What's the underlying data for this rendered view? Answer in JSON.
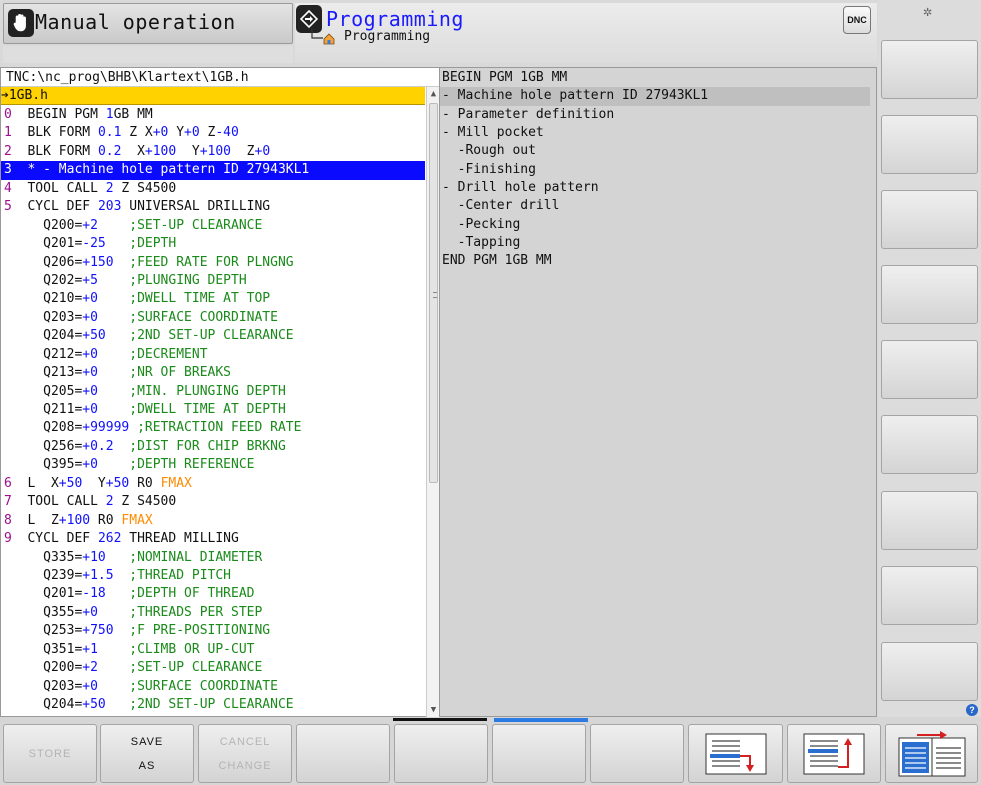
{
  "header": {
    "mode_title": "Manual operation",
    "programming_title": "Programming",
    "programming_subtitle": "Programming",
    "dnc_label": "DNC"
  },
  "editor": {
    "path": "TNC:\\nc_prog\\BHB\\Klartext\\1GB.h",
    "file_name": "1GB.h",
    "selected_line": 3,
    "lines": [
      {
        "num": "0",
        "text": "BEGIN PGM 1GB MM"
      },
      {
        "num": "1",
        "text": "BLK FORM 0.1 Z X+0 Y+0 Z-40"
      },
      {
        "num": "2",
        "text": "BLK FORM 0.2  X+100  Y+100  Z+0"
      },
      {
        "num": "3",
        "text": "* - Machine hole pattern ID 27943KL1"
      },
      {
        "num": "4",
        "text": "TOOL CALL 2 Z S4500"
      },
      {
        "num": "5",
        "text": "CYCL DEF 203 UNIVERSAL DRILLING"
      },
      {
        "num": "",
        "text": "  Q200=+2    ;SET-UP CLEARANCE"
      },
      {
        "num": "",
        "text": "  Q201=-25   ;DEPTH"
      },
      {
        "num": "",
        "text": "  Q206=+150  ;FEED RATE FOR PLNGNG"
      },
      {
        "num": "",
        "text": "  Q202=+5    ;PLUNGING DEPTH"
      },
      {
        "num": "",
        "text": "  Q210=+0    ;DWELL TIME AT TOP"
      },
      {
        "num": "",
        "text": "  Q203=+0    ;SURFACE COORDINATE"
      },
      {
        "num": "",
        "text": "  Q204=+50   ;2ND SET-UP CLEARANCE"
      },
      {
        "num": "",
        "text": "  Q212=+0    ;DECREMENT"
      },
      {
        "num": "",
        "text": "  Q213=+0    ;NR OF BREAKS"
      },
      {
        "num": "",
        "text": "  Q205=+0    ;MIN. PLUNGING DEPTH"
      },
      {
        "num": "",
        "text": "  Q211=+0    ;DWELL TIME AT DEPTH"
      },
      {
        "num": "",
        "text": "  Q208=+99999 ;RETRACTION FEED RATE"
      },
      {
        "num": "",
        "text": "  Q256=+0.2  ;DIST FOR CHIP BRKNG"
      },
      {
        "num": "",
        "text": "  Q395=+0    ;DEPTH REFERENCE"
      },
      {
        "num": "6",
        "text": "L  X+50  Y+50 R0 FMAX"
      },
      {
        "num": "7",
        "text": "TOOL CALL 2 Z S4500"
      },
      {
        "num": "8",
        "text": "L  Z+100 R0 FMAX"
      },
      {
        "num": "9",
        "text": "CYCL DEF 262 THREAD MILLING"
      },
      {
        "num": "",
        "text": "  Q335=+10   ;NOMINAL DIAMETER"
      },
      {
        "num": "",
        "text": "  Q239=+1.5  ;THREAD PITCH"
      },
      {
        "num": "",
        "text": "  Q201=-18   ;DEPTH OF THREAD"
      },
      {
        "num": "",
        "text": "  Q355=+0    ;THREADS PER STEP"
      },
      {
        "num": "",
        "text": "  Q253=+750  ;F PRE-POSITIONING"
      },
      {
        "num": "",
        "text": "  Q351=+1    ;CLIMB OR UP-CUT"
      },
      {
        "num": "",
        "text": "  Q200=+2    ;SET-UP CLEARANCE"
      },
      {
        "num": "",
        "text": "  Q203=+0    ;SURFACE COORDINATE"
      },
      {
        "num": "",
        "text": "  Q204=+50   ;2ND SET-UP CLEARANCE"
      }
    ]
  },
  "structure": {
    "highlighted_index": 1,
    "items": [
      "BEGIN PGM 1GB MM",
      "- Machine hole pattern ID 27943KL1",
      "- Parameter definition",
      "- Mill pocket",
      "  -Rough out",
      "  -Finishing",
      "- Drill hole pattern",
      "  -Center drill",
      "  -Pecking",
      "  -Tapping",
      "END PGM 1GB MM"
    ]
  },
  "softkeys": {
    "store": "STORE",
    "save_as_1": "SAVE",
    "save_as_2": "AS",
    "cancel_1": "CANCEL",
    "cancel_2": "CHANGE"
  },
  "colors": {
    "selection": "#0a0aff",
    "file_bar": "#ffd200",
    "line_number": "#9b0f8f",
    "value": "#1010ff",
    "comment": "#1a8a1a",
    "fmax": "#ff8a00",
    "programming_title": "#1a1aff",
    "active_page_bar": "#2c7be5"
  },
  "icons": [
    "hand-icon",
    "programming-mode-icon",
    "home-icon",
    "dnc-icon",
    "settings-icon",
    "help-icon",
    "block-down-icon",
    "block-up-icon",
    "split-screen-icon"
  ]
}
